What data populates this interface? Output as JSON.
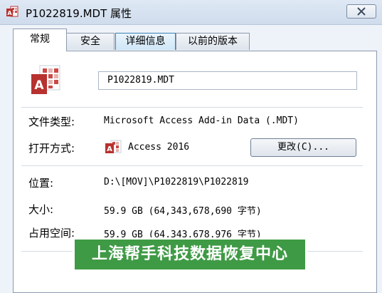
{
  "window": {
    "title": "P1022819.MDT 属性",
    "title_icon": "access-file-icon",
    "close_icon": "close-icon"
  },
  "tabs": [
    {
      "label": "常规",
      "active": true
    },
    {
      "label": "安全",
      "active": false
    },
    {
      "label": "详细信息",
      "active": false
    },
    {
      "label": "以前的版本",
      "active": false
    }
  ],
  "general": {
    "file_icon": "access-file-icon",
    "filename": "P1022819.MDT",
    "file_type_label": "文件类型:",
    "file_type_value": "Microsoft Access Add-in Data (.MDT)",
    "open_with_label": "打开方式:",
    "open_with_app": "Access 2016",
    "open_with_icon": "access-app-icon",
    "change_button": "更改(C)...",
    "location_label": "位置:",
    "location_value": "D:\\[MOV]\\P1022819\\P1022819",
    "size_label": "大小:",
    "size_value": "59.9 GB (64,343,678,690 字节)",
    "size_on_disk_label": "占用空间:",
    "size_on_disk_value": "59.9 GB (64,343,678,976 字节)"
  },
  "watermark": {
    "text": "上海帮手科技数据恢复中心",
    "color": "#3f9a45"
  },
  "colors": {
    "access_red": "#b7312f",
    "window_bg": "#eef3f9"
  }
}
